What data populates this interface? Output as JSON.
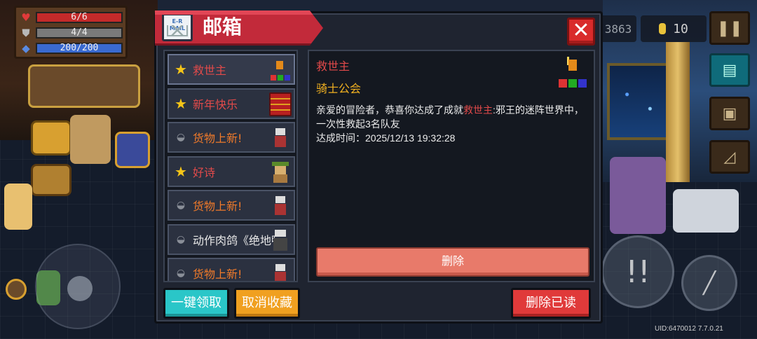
{
  "hud": {
    "health": "6/6",
    "armor": "4/4",
    "energy": "200/200",
    "health_level": 1.0,
    "armor_level": 1.0,
    "energy_level": 1.0,
    "coins": "3863",
    "gems": "10",
    "uid": "UID:6470012 7.7.0.21"
  },
  "mail": {
    "title": "邮箱",
    "icon_text": "E-R MAIL",
    "close_label": "✕",
    "items": [
      {
        "label": "救世主",
        "mark": "star",
        "color": "red",
        "thumb": "trophy"
      },
      {
        "label": "新年快乐",
        "mark": "star",
        "color": "red",
        "thumb": "chest"
      },
      {
        "label": "货物上新!",
        "mark": "envelope",
        "color": "orange",
        "thumb": "knight"
      },
      {
        "label": "好诗",
        "mark": "star",
        "color": "red",
        "thumb": "poet"
      },
      {
        "label": "货物上新!",
        "mark": "envelope",
        "color": "orange",
        "thumb": "knight"
      },
      {
        "label": "动作肉鸽《绝地鸭",
        "mark": "envelope",
        "color": "white",
        "thumb": "dark"
      },
      {
        "label": "货物上新!",
        "mark": "envelope",
        "color": "orange",
        "thumb": "knight"
      }
    ],
    "detail": {
      "title": "救世主",
      "sender": "骑士公会",
      "body_prefix": "亲爱的冒险者，恭喜你达成了成就",
      "body_highlight": "救世主",
      "body_suffix": ":邪王的迷阵世界中，一次性救起3名队友",
      "time": "达成时间：2025/12/13 19:32:28",
      "delete_label": "删除"
    },
    "buttons": {
      "claim_all": "一键领取",
      "unfavorite": "取消收藏",
      "delete_read": "删除已读"
    }
  }
}
